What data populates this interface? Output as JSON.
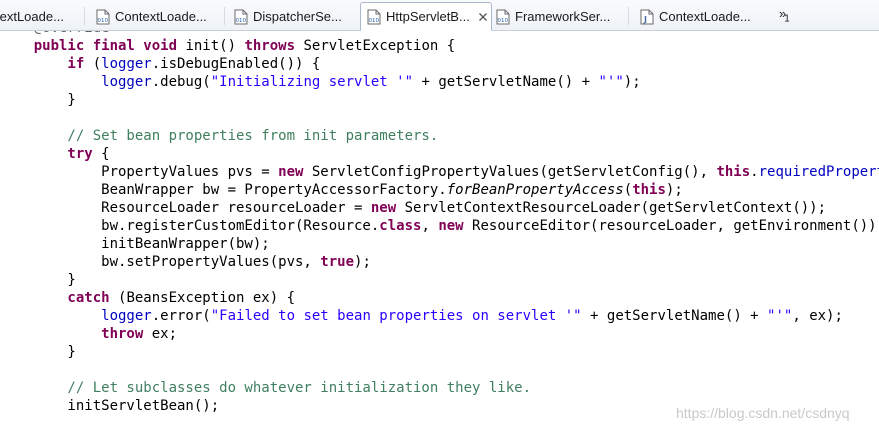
{
  "tabs": [
    {
      "label": "textLoade...",
      "icon": "class-file-icon"
    },
    {
      "label": "ContextLoade...",
      "icon": "class-file-icon"
    },
    {
      "label": "DispatcherSe...",
      "icon": "class-file-icon"
    },
    {
      "label": "HttpServletB...",
      "icon": "class-file-icon",
      "active": true
    },
    {
      "label": "FrameworkSer...",
      "icon": "class-file-icon"
    },
    {
      "label": "ContextLoade...",
      "icon": "java-file-icon"
    }
  ],
  "overflow": {
    "chevron": "»",
    "count": "1"
  },
  "code": {
    "line0": [
      {
        "c": "ann",
        "t": "    @Override"
      }
    ],
    "line1": [
      {
        "c": "kw",
        "t": "    public final void "
      },
      {
        "c": "",
        "t": "init() "
      },
      {
        "c": "kw",
        "t": "throws "
      },
      {
        "c": "",
        "t": "ServletException {"
      }
    ],
    "line2": [
      {
        "c": "kw",
        "t": "        if "
      },
      {
        "c": "",
        "t": "("
      },
      {
        "c": "fld",
        "t": "logger"
      },
      {
        "c": "",
        "t": ".isDebugEnabled()) {"
      }
    ],
    "line3": [
      {
        "c": "fld",
        "t": "            logger"
      },
      {
        "c": "",
        "t": ".debug("
      },
      {
        "c": "str",
        "t": "\"Initializing servlet '\""
      },
      {
        "c": "",
        "t": " + getServletName() + "
      },
      {
        "c": "str",
        "t": "\"'\""
      },
      {
        "c": "",
        "t": ");"
      }
    ],
    "line4": [
      {
        "c": "",
        "t": "        }"
      }
    ],
    "line5": [
      {
        "c": "",
        "t": ""
      }
    ],
    "line6": [
      {
        "c": "cm",
        "t": "        // Set bean properties from init parameters."
      }
    ],
    "line7": [
      {
        "c": "kw",
        "t": "        try "
      },
      {
        "c": "",
        "t": "{"
      }
    ],
    "line8": [
      {
        "c": "",
        "t": "            PropertyValues pvs = "
      },
      {
        "c": "kw",
        "t": "new "
      },
      {
        "c": "",
        "t": "ServletConfigPropertyValues(getServletConfig(), "
      },
      {
        "c": "kw",
        "t": "this"
      },
      {
        "c": "",
        "t": "."
      },
      {
        "c": "fld",
        "t": "requiredProperties"
      },
      {
        "c": "",
        "t": ");"
      }
    ],
    "line9": [
      {
        "c": "",
        "t": "            BeanWrapper bw = PropertyAccessorFactory."
      },
      {
        "c": "it",
        "t": "forBeanPropertyAccess"
      },
      {
        "c": "",
        "t": "("
      },
      {
        "c": "kw",
        "t": "this"
      },
      {
        "c": "",
        "t": ");"
      }
    ],
    "line10": [
      {
        "c": "",
        "t": "            ResourceLoader resourceLoader = "
      },
      {
        "c": "kw",
        "t": "new "
      },
      {
        "c": "",
        "t": "ServletContextResourceLoader(getServletContext());"
      }
    ],
    "line11": [
      {
        "c": "",
        "t": "            bw.registerCustomEditor(Resource."
      },
      {
        "c": "kw",
        "t": "class"
      },
      {
        "c": "",
        "t": ", "
      },
      {
        "c": "kw",
        "t": "new "
      },
      {
        "c": "",
        "t": "ResourceEditor(resourceLoader, getEnvironment()));"
      }
    ],
    "line12": [
      {
        "c": "",
        "t": "            initBeanWrapper(bw);"
      }
    ],
    "line13": [
      {
        "c": "",
        "t": "            bw.setPropertyValues(pvs, "
      },
      {
        "c": "kw",
        "t": "true"
      },
      {
        "c": "",
        "t": ");"
      }
    ],
    "line14": [
      {
        "c": "",
        "t": "        }"
      }
    ],
    "line15": [
      {
        "c": "kw",
        "t": "        catch "
      },
      {
        "c": "",
        "t": "(BeansException ex) {"
      }
    ],
    "line16": [
      {
        "c": "fld",
        "t": "            logger"
      },
      {
        "c": "",
        "t": ".error("
      },
      {
        "c": "str",
        "t": "\"Failed to set bean properties on servlet '\""
      },
      {
        "c": "",
        "t": " + getServletName() + "
      },
      {
        "c": "str",
        "t": "\"'\""
      },
      {
        "c": "",
        "t": ", ex);"
      }
    ],
    "line17": [
      {
        "c": "kw",
        "t": "            throw "
      },
      {
        "c": "",
        "t": "ex;"
      }
    ],
    "line18": [
      {
        "c": "",
        "t": "        }"
      }
    ],
    "line19": [
      {
        "c": "",
        "t": ""
      }
    ],
    "line20": [
      {
        "c": "cm",
        "t": "        // Let subclasses do whatever initialization they like."
      }
    ],
    "line21": [
      {
        "c": "",
        "t": "        initServletBean();"
      }
    ]
  },
  "watermark": "https://blog.csdn.net/csdnyq"
}
